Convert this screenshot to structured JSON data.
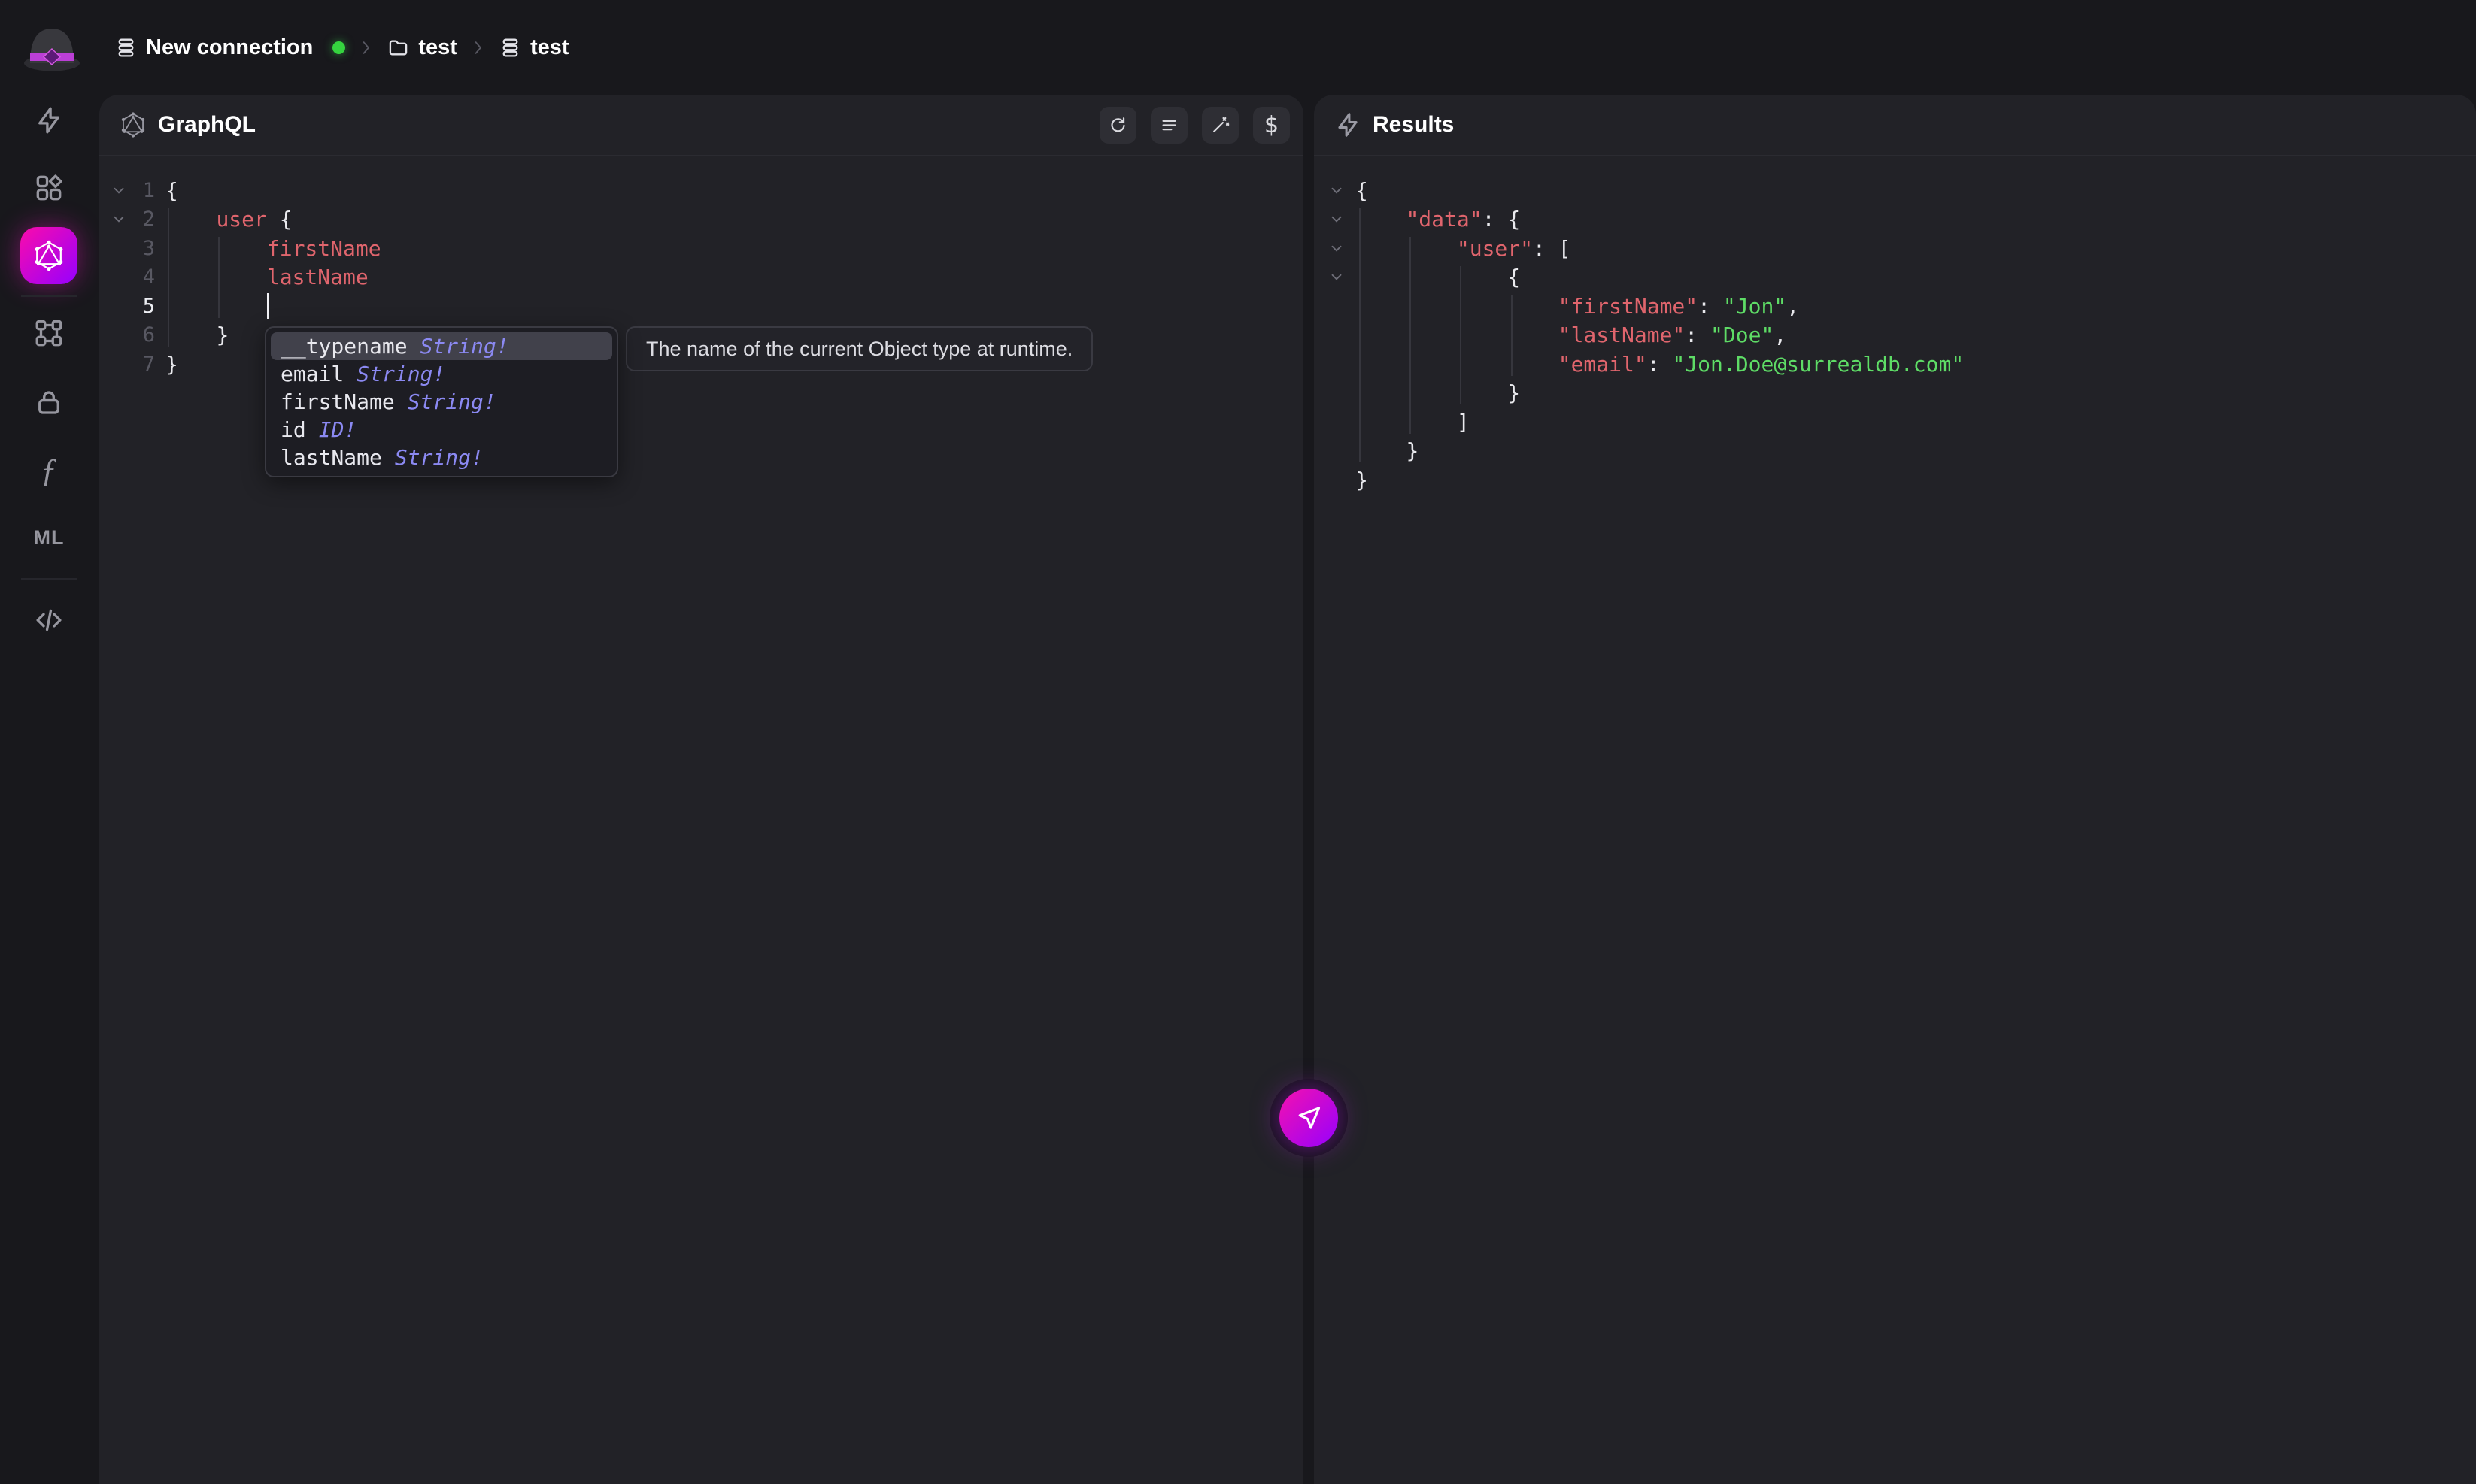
{
  "topbar": {
    "breadcrumb": [
      {
        "icon": "instance-icon",
        "label": "New connection",
        "status_dot": true
      },
      {
        "icon": "folder-icon",
        "label": "test"
      },
      {
        "icon": "database-icon",
        "label": "test"
      }
    ]
  },
  "sidebar": {
    "items": [
      {
        "name": "query",
        "icon": "bolt-icon",
        "active": false
      },
      {
        "name": "explorer",
        "icon": "dashboard-icon",
        "active": false
      },
      {
        "name": "graphql",
        "icon": "graphql-icon",
        "active": true
      },
      {
        "name": "divider"
      },
      {
        "name": "designer",
        "icon": "nodes-icon",
        "active": false
      },
      {
        "name": "authentication",
        "icon": "lock-icon",
        "active": false
      },
      {
        "name": "functions",
        "icon": "function-icon",
        "glyph": "ƒ",
        "active": false
      },
      {
        "name": "models",
        "icon": "ml-icon",
        "glyph": "ML",
        "active": false
      },
      {
        "name": "divider"
      },
      {
        "name": "api-docs",
        "icon": "code-icon",
        "active": false
      }
    ]
  },
  "graphql_panel": {
    "title": "GraphQL",
    "toolbar": [
      {
        "name": "refresh-button",
        "icon": "refresh-icon"
      },
      {
        "name": "format-button",
        "icon": "format-icon"
      },
      {
        "name": "infer-button",
        "icon": "wand-icon"
      },
      {
        "name": "variables-button",
        "icon": "dollar-icon",
        "glyph": "$"
      }
    ],
    "editor": {
      "lines": [
        {
          "num": 1,
          "fold": true,
          "tokens": [
            {
              "c": "p",
              "t": "{"
            }
          ]
        },
        {
          "num": 2,
          "fold": true,
          "tokens": [
            {
              "c": "p",
              "t": "    "
            },
            {
              "c": "k",
              "t": "user"
            },
            {
              "c": "p",
              "t": " {"
            }
          ]
        },
        {
          "num": 3,
          "tokens": [
            {
              "c": "p",
              "t": "        "
            },
            {
              "c": "k",
              "t": "firstName"
            }
          ]
        },
        {
          "num": 4,
          "tokens": [
            {
              "c": "p",
              "t": "        "
            },
            {
              "c": "k",
              "t": "lastName"
            }
          ]
        },
        {
          "num": 5,
          "active": true,
          "cursor": true,
          "tokens": [
            {
              "c": "p",
              "t": "        "
            }
          ]
        },
        {
          "num": 6,
          "tokens": [
            {
              "c": "p",
              "t": "    "
            },
            {
              "c": "p",
              "t": "}"
            }
          ]
        },
        {
          "num": 7,
          "tokens": [
            {
              "c": "p",
              "t": "}"
            }
          ]
        }
      ],
      "guides": [
        {
          "level": 0,
          "from": 2,
          "to": 6
        },
        {
          "level": 1,
          "from": 3,
          "to": 5
        }
      ]
    },
    "autocomplete": {
      "items": [
        {
          "name": "__typename",
          "type": "String!",
          "selected": true
        },
        {
          "name": "email",
          "type": "String!",
          "selected": false
        },
        {
          "name": "firstName",
          "type": "String!",
          "selected": false
        },
        {
          "name": "id",
          "type": "ID!",
          "selected": false
        },
        {
          "name": "lastName",
          "type": "String!",
          "selected": false
        }
      ]
    },
    "tooltip": {
      "text": "The name of the current Object type at runtime."
    }
  },
  "results_panel": {
    "title": "Results",
    "lines": [
      {
        "fold": true,
        "tokens": [
          {
            "c": "p",
            "t": "{"
          }
        ]
      },
      {
        "fold": true,
        "tokens": [
          {
            "c": "p",
            "t": "    "
          },
          {
            "c": "k",
            "t": "\"data\""
          },
          {
            "c": "c",
            "t": ": "
          },
          {
            "c": "p",
            "t": "{"
          }
        ]
      },
      {
        "fold": true,
        "tokens": [
          {
            "c": "p",
            "t": "        "
          },
          {
            "c": "k",
            "t": "\"user\""
          },
          {
            "c": "c",
            "t": ": "
          },
          {
            "c": "p",
            "t": "["
          }
        ]
      },
      {
        "fold": true,
        "tokens": [
          {
            "c": "p",
            "t": "            "
          },
          {
            "c": "p",
            "t": "{"
          }
        ]
      },
      {
        "tokens": [
          {
            "c": "p",
            "t": "                "
          },
          {
            "c": "k",
            "t": "\"firstName\""
          },
          {
            "c": "c",
            "t": ": "
          },
          {
            "c": "s",
            "t": "\"Jon\""
          },
          {
            "c": "c",
            "t": ","
          }
        ]
      },
      {
        "tokens": [
          {
            "c": "p",
            "t": "                "
          },
          {
            "c": "k",
            "t": "\"lastName\""
          },
          {
            "c": "c",
            "t": ": "
          },
          {
            "c": "s",
            "t": "\"Doe\""
          },
          {
            "c": "c",
            "t": ","
          }
        ]
      },
      {
        "tokens": [
          {
            "c": "p",
            "t": "                "
          },
          {
            "c": "k",
            "t": "\"email\""
          },
          {
            "c": "c",
            "t": ": "
          },
          {
            "c": "s",
            "t": "\"Jon.Doe@surrealdb.com\""
          }
        ]
      },
      {
        "tokens": [
          {
            "c": "p",
            "t": "            "
          },
          {
            "c": "p",
            "t": "}"
          }
        ]
      },
      {
        "tokens": [
          {
            "c": "p",
            "t": "        "
          },
          {
            "c": "p",
            "t": "]"
          }
        ]
      },
      {
        "tokens": [
          {
            "c": "p",
            "t": "    "
          },
          {
            "c": "p",
            "t": "}"
          }
        ]
      },
      {
        "tokens": [
          {
            "c": "p",
            "t": "}"
          }
        ]
      }
    ],
    "guides": [
      {
        "level": 0,
        "from": 2,
        "to": 10
      },
      {
        "level": 1,
        "from": 3,
        "to": 9
      },
      {
        "level": 2,
        "from": 4,
        "to": 8
      },
      {
        "level": 3,
        "from": 5,
        "to": 7
      }
    ]
  },
  "send_button": {
    "name": "run-query-button",
    "icon": "send-icon"
  },
  "colors": {
    "accent_gradient_from": "#fb0bab",
    "accent_gradient_to": "#9600ff",
    "key_color": "#e0656d",
    "string_color": "#5edc66",
    "type_color": "#8b89f2",
    "status_green": "#35d33f"
  }
}
